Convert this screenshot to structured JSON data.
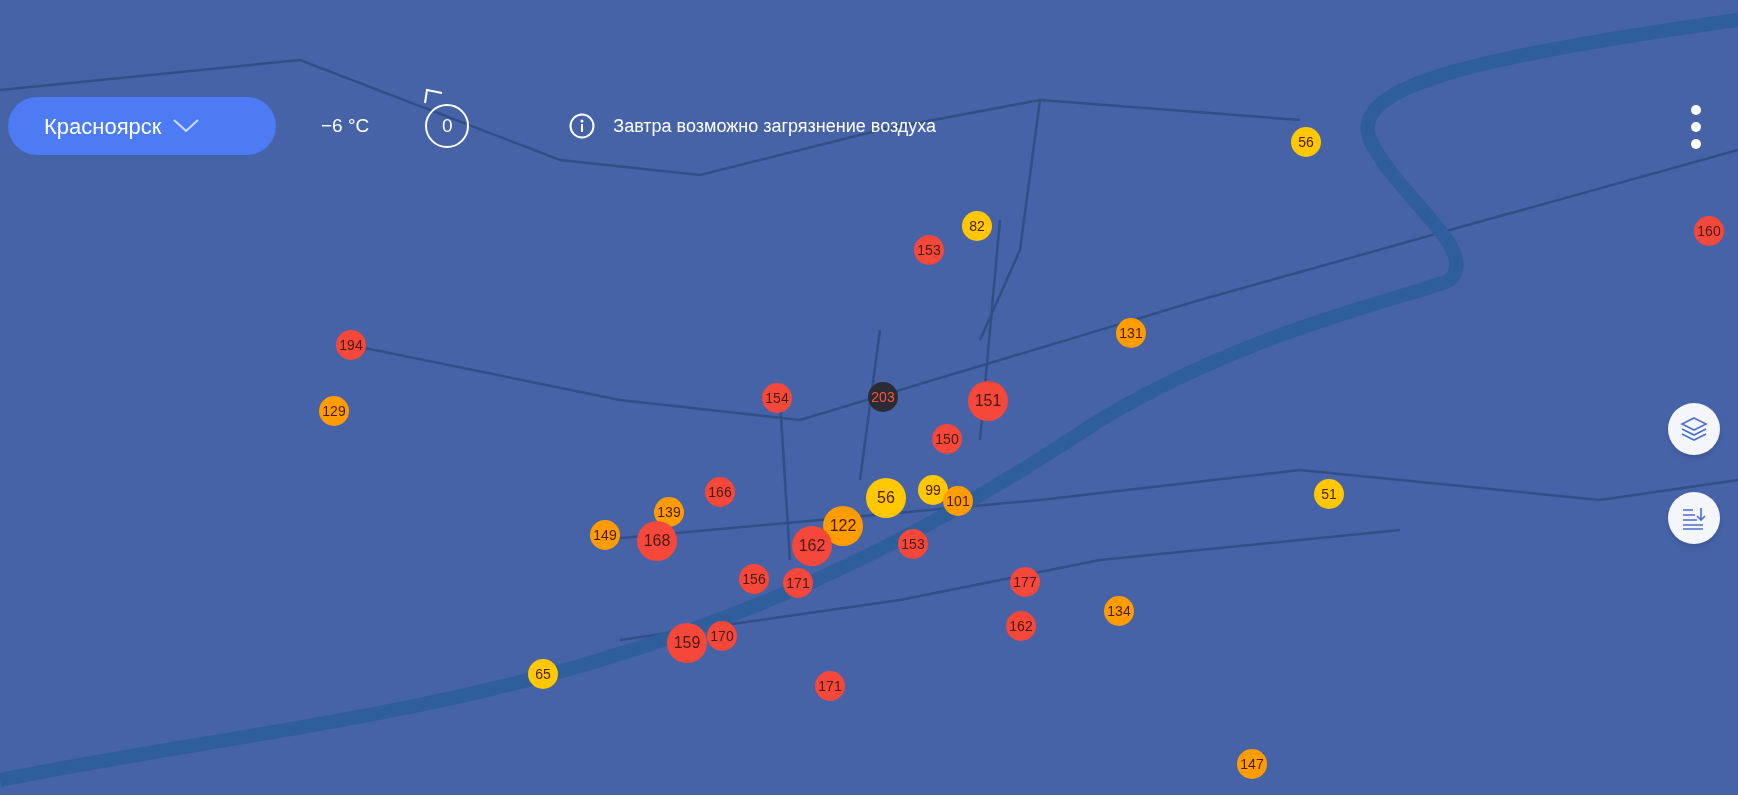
{
  "header": {
    "city": "Красноярск",
    "temperature": "−6 °C",
    "counter": "0",
    "alert": "Завтра возможно загрязнение воздуха"
  },
  "markers": [
    {
      "value": "56",
      "color": "#ffc800",
      "kind": "small"
    },
    {
      "value": "82",
      "color": "#ffc800",
      "kind": "small"
    },
    {
      "value": "153",
      "color": "#f5483a",
      "kind": "small"
    },
    {
      "value": "160",
      "color": "#f5483a",
      "kind": "small"
    },
    {
      "value": "194",
      "color": "#f5483a",
      "kind": "small"
    },
    {
      "value": "131",
      "color": "#ff9c00",
      "kind": "small"
    },
    {
      "value": "129",
      "color": "#ff9c00",
      "kind": "small"
    },
    {
      "value": "154",
      "color": "#f5483a",
      "kind": "small"
    },
    {
      "value": "203",
      "color": "#2b2b33",
      "kind": "small"
    },
    {
      "value": "151",
      "color": "#f5483a",
      "kind": "large"
    },
    {
      "value": "150",
      "color": "#f5483a",
      "kind": "small"
    },
    {
      "value": "166",
      "color": "#f5483a",
      "kind": "small"
    },
    {
      "value": "56",
      "color": "#ffc800",
      "kind": "large"
    },
    {
      "value": "99",
      "color": "#ffc800",
      "kind": "small"
    },
    {
      "value": "101",
      "color": "#ff9c00",
      "kind": "small"
    },
    {
      "value": "51",
      "color": "#ffc800",
      "kind": "small"
    },
    {
      "value": "139",
      "color": "#ff9c00",
      "kind": "small"
    },
    {
      "value": "149",
      "color": "#ff9c00",
      "kind": "small"
    },
    {
      "value": "168",
      "color": "#f5483a",
      "kind": "large"
    },
    {
      "value": "122",
      "color": "#ff9c00",
      "kind": "large"
    },
    {
      "value": "162",
      "color": "#f5483a",
      "kind": "large"
    },
    {
      "value": "153",
      "color": "#f5483a",
      "kind": "small"
    },
    {
      "value": "156",
      "color": "#f5483a",
      "kind": "small"
    },
    {
      "value": "171",
      "color": "#f5483a",
      "kind": "small"
    },
    {
      "value": "177",
      "color": "#f5483a",
      "kind": "small"
    },
    {
      "value": "134",
      "color": "#ff9c00",
      "kind": "small"
    },
    {
      "value": "162",
      "color": "#f5483a",
      "kind": "small"
    },
    {
      "value": "159",
      "color": "#f5483a",
      "kind": "large"
    },
    {
      "value": "170",
      "color": "#f5483a",
      "kind": "small"
    },
    {
      "value": "65",
      "color": "#ffc800",
      "kind": "small"
    },
    {
      "value": "171",
      "color": "#f5483a",
      "kind": "small"
    },
    {
      "value": "147",
      "color": "#ff9c00",
      "kind": "small"
    }
  ]
}
